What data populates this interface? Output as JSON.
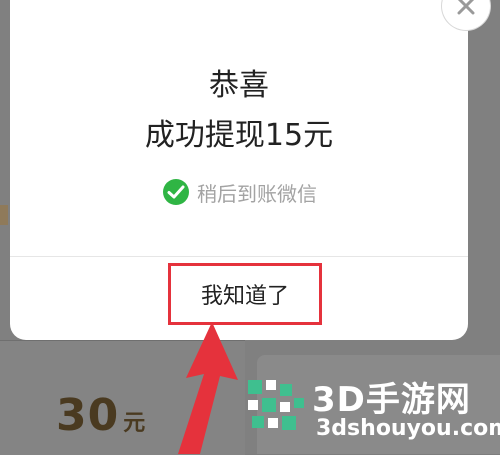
{
  "background": {
    "amount_value": "30",
    "amount_unit": "元"
  },
  "dialog": {
    "title": "恭喜",
    "message": "成功提现15元",
    "sub_text": "稍后到账微信",
    "confirm_label": "我知道了",
    "close_icon": "close-icon",
    "wechat_icon": "wechat-icon",
    "colors": {
      "highlight_border": "#e5323c",
      "wechat_green": "#2fb544",
      "muted_text": "#a3a3a3"
    }
  },
  "watermark": {
    "name": "3D手游网",
    "url": "3dshouyou.com"
  }
}
